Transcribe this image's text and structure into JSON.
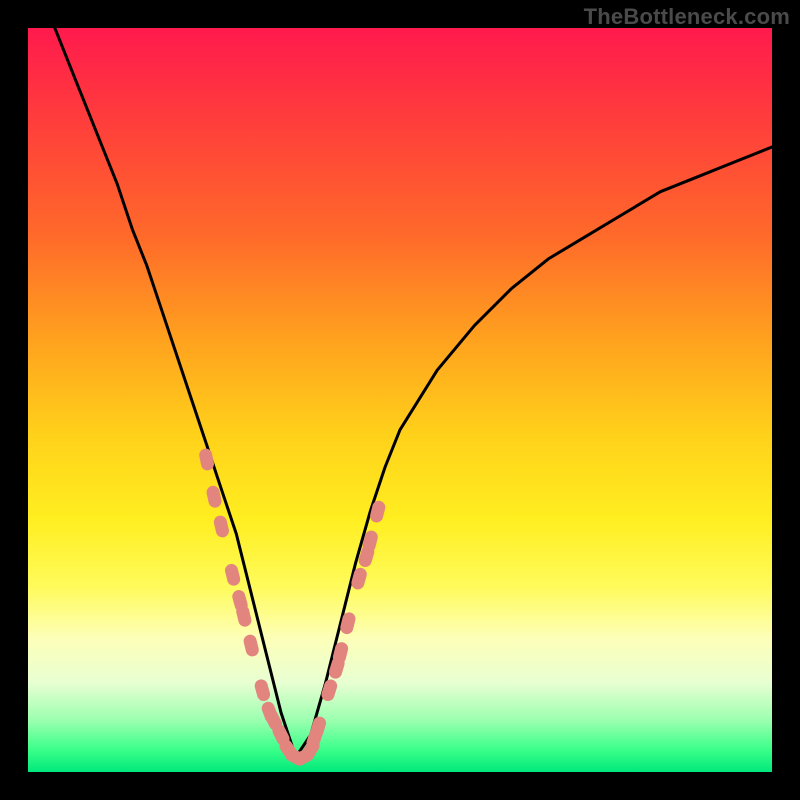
{
  "watermark": {
    "text": "TheBottleneck.com"
  },
  "chart_data": {
    "type": "line",
    "title": "",
    "xlabel": "",
    "ylabel": "",
    "xlim": [
      0,
      100
    ],
    "ylim": [
      0,
      100
    ],
    "grid": false,
    "legend": false,
    "series": [
      {
        "name": "bottleneck-curve",
        "x": [
          0,
          2,
          4,
          6,
          8,
          10,
          12,
          14,
          16,
          18,
          20,
          22,
          24,
          26,
          28,
          30,
          32,
          34,
          36,
          38,
          40,
          42,
          44,
          46,
          48,
          50,
          55,
          60,
          65,
          70,
          75,
          80,
          85,
          90,
          95,
          100
        ],
        "y": [
          108,
          104,
          99,
          94,
          89,
          84,
          79,
          73,
          68,
          62,
          56,
          50,
          44,
          38,
          32,
          24,
          16,
          8,
          2,
          5,
          12,
          20,
          28,
          35,
          41,
          46,
          54,
          60,
          65,
          69,
          72,
          75,
          78,
          80,
          82,
          84
        ]
      }
    ],
    "markers": {
      "name": "beads",
      "color": "#e2857f",
      "points": [
        [
          24.0,
          42.0
        ],
        [
          25.0,
          37.0
        ],
        [
          26.0,
          33.0
        ],
        [
          27.5,
          26.5
        ],
        [
          28.5,
          23.0
        ],
        [
          29.0,
          21.0
        ],
        [
          30.0,
          17.0
        ],
        [
          31.5,
          11.0
        ],
        [
          32.5,
          8.0
        ],
        [
          33.0,
          7.0
        ],
        [
          34.0,
          5.0
        ],
        [
          35.0,
          3.0
        ],
        [
          36.0,
          2.0
        ],
        [
          37.0,
          2.0
        ],
        [
          38.0,
          3.0
        ],
        [
          38.5,
          4.5
        ],
        [
          39.0,
          6.0
        ],
        [
          40.5,
          11.0
        ],
        [
          41.5,
          14.0
        ],
        [
          42.0,
          16.0
        ],
        [
          43.0,
          20.0
        ],
        [
          44.5,
          26.0
        ],
        [
          45.5,
          29.0
        ],
        [
          46.0,
          31.0
        ],
        [
          47.0,
          35.0
        ]
      ]
    }
  }
}
